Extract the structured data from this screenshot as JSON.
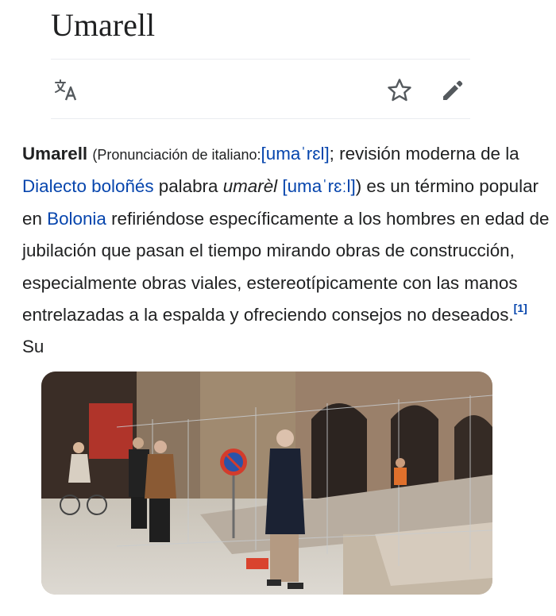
{
  "page": {
    "title": "Umarell"
  },
  "toolbar": {
    "language_icon": "translate-icon",
    "watch_icon": "star-icon",
    "edit_icon": "pencil-icon"
  },
  "article": {
    "term": "Umarell",
    "pron_open": "(Pronunciación de italiano:",
    "ipa_1": "[umaˈrɛl]",
    "text_1": "; revisión moderna de la ",
    "link_dialect": "Dialecto boloñés",
    "text_2": " palabra ",
    "word_italic": "umarèl",
    "text_3": " ",
    "ipa_2": "[umaˈrɛːl]",
    "text_4": ") es un término popular en ",
    "link_bologna": "Bolonia",
    "text_5": " refiriéndose específicamente a los hombres en edad de jubilación que pasan el tiempo mirando obras de construcción, especialmente obras viales, estereotípicamente con las manos entrelazadas a la espalda y ofreciendo consejos no deseados.",
    "ref_1": "[1]",
    "text_6": " Su"
  },
  "photo": {
    "subject": "elderly-men-watching-road-works-photo"
  },
  "colors": {
    "link": "#0645ad",
    "text": "#202122",
    "rule": "#eaecf0",
    "icon": "#54595d"
  }
}
